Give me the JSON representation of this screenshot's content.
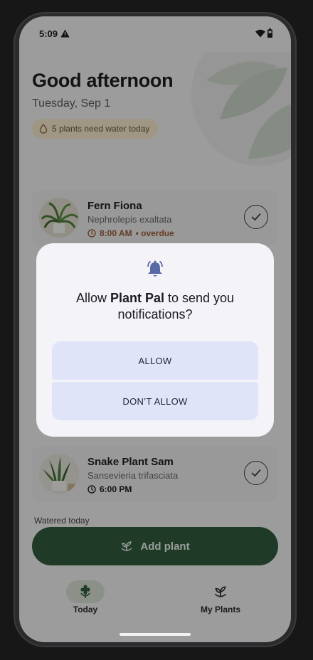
{
  "status_bar": {
    "time": "5:09"
  },
  "header": {
    "greeting": "Good afternoon",
    "date": "Tuesday, Sep 1",
    "water_notice": "5 plants need water today"
  },
  "plants": [
    {
      "name": "Fern Fiona",
      "scientific": "Nephrolepis exaltata",
      "time": "8:00 AM",
      "status": "• overdue",
      "time_color": "#9a5a33"
    },
    {
      "name": "Snake Plant Sam",
      "scientific": "Sansevieria trifasciata",
      "time": "6:00 PM",
      "status": "",
      "time_color": "#1e1e1e"
    }
  ],
  "watered_section": {
    "label": "Watered today"
  },
  "fab": {
    "label": "Add plant"
  },
  "nav": {
    "today_label": "Today",
    "plants_label": "My Plants"
  },
  "dialog": {
    "prefix": "Allow ",
    "app_name": "Plant Pal",
    "suffix": " to send you notifications?",
    "allow_label": "ALLOW",
    "deny_label": "DON’T ALLOW"
  },
  "colors": {
    "accent": "#2f5a3e",
    "dialog_accent": "#5a6aa6",
    "overdue": "#9a5a33"
  },
  "icons": [
    "warning-icon",
    "wifi-icon",
    "battery-icon",
    "droplet-icon",
    "clock-icon",
    "check-icon",
    "sprout-icon",
    "flower-icon",
    "bell-icon"
  ]
}
